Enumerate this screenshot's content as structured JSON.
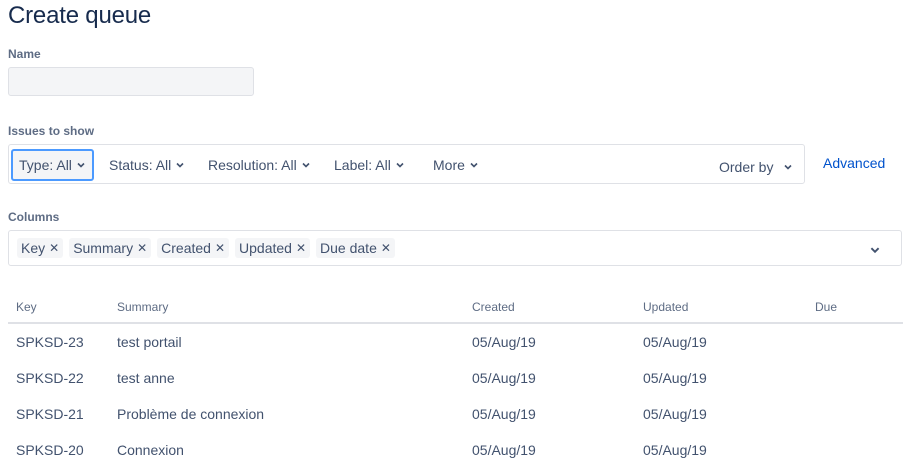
{
  "page": {
    "title": "Create queue"
  },
  "name_field": {
    "label": "Name",
    "value": "",
    "placeholder": ""
  },
  "issues_to_show": {
    "label": "Issues to show",
    "filters": [
      {
        "label": "Type: All"
      },
      {
        "label": "Status: All"
      },
      {
        "label": "Resolution: All"
      },
      {
        "label": "Label: All"
      },
      {
        "label": "More"
      }
    ],
    "order_by": "Order by",
    "advanced": "Advanced"
  },
  "columns": {
    "label": "Columns",
    "tags": [
      "Key",
      "Summary",
      "Created",
      "Updated",
      "Due date"
    ]
  },
  "table": {
    "headers": [
      "Key",
      "Summary",
      "Created",
      "Updated",
      "Due"
    ],
    "rows": [
      {
        "key": "SPKSD-23",
        "summary": "test portail",
        "created": "05/Aug/19",
        "updated": "05/Aug/19",
        "due": ""
      },
      {
        "key": "SPKSD-22",
        "summary": "test anne",
        "created": "05/Aug/19",
        "updated": "05/Aug/19",
        "due": ""
      },
      {
        "key": "SPKSD-21",
        "summary": "Problème de connexion",
        "created": "05/Aug/19",
        "updated": "05/Aug/19",
        "due": ""
      },
      {
        "key": "SPKSD-20",
        "summary": "Connexion",
        "created": "05/Aug/19",
        "updated": "05/Aug/19",
        "due": ""
      }
    ]
  },
  "colors": {
    "accent": "#0052cc",
    "focus": "#4c9aff",
    "text": "#172b4d",
    "muted": "#5e6c84"
  }
}
